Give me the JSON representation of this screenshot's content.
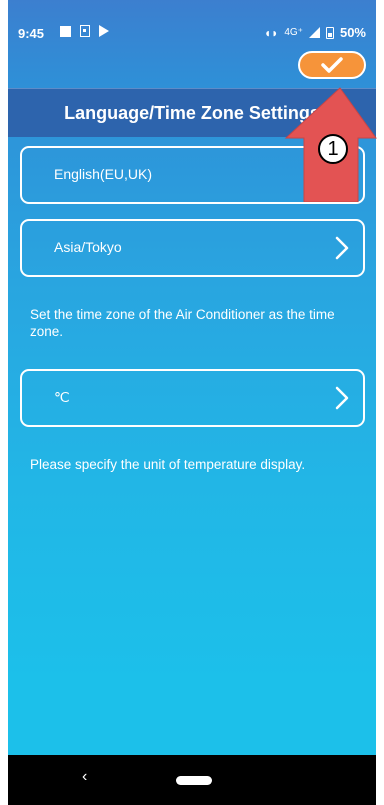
{
  "status_bar": {
    "time": "9:45",
    "network": "4G⁺",
    "battery": "50%"
  },
  "header": {
    "title": "Language/Time Zone Settings"
  },
  "settings": {
    "language": {
      "value": "English(EU,UK)"
    },
    "time_zone": {
      "value": "Asia/Tokyo",
      "description": "Set the time zone of the Air Conditioner as the time zone."
    },
    "temperature_unit": {
      "value": "℃",
      "description": "Please specify the unit of temperature display."
    }
  },
  "nav": {
    "back": "‹"
  },
  "annotation": {
    "number": "1"
  },
  "colors": {
    "accent": "#f6943a",
    "header": "#2d64ad",
    "annotation_arrow": "#e35353"
  }
}
